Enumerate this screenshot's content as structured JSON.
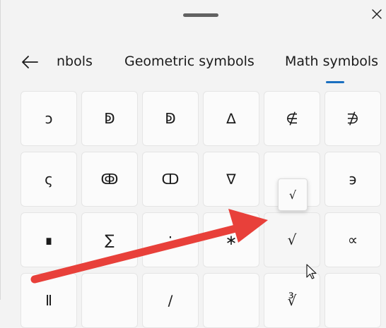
{
  "window": {
    "close_icon": "close-icon",
    "drag_handle_icon": "drag-handle-icon"
  },
  "nav": {
    "back_icon": "back-arrow-icon",
    "tabs": [
      {
        "label": "nbols"
      },
      {
        "label": "Geometric symbols"
      },
      {
        "label": "Math symbols",
        "selected": true
      }
    ]
  },
  "symbols": {
    "row1": [
      "ↄ",
      "ↁ",
      "ↁ",
      "∆",
      "∉",
      "∌"
    ],
    "row2": [
      "ς",
      "ↂ",
      "ↀ",
      "∇",
      "",
      "϶"
    ],
    "row3": [
      "∎",
      "∑",
      "∶",
      "∗",
      "√",
      "∝"
    ],
    "row4": [
      "Ⅱ",
      "",
      "∕",
      "",
      "∛",
      ""
    ]
  },
  "tooltip": {
    "symbol": "√"
  },
  "accent_color": "#1a6fc0",
  "annotation_color": "#e8403a"
}
